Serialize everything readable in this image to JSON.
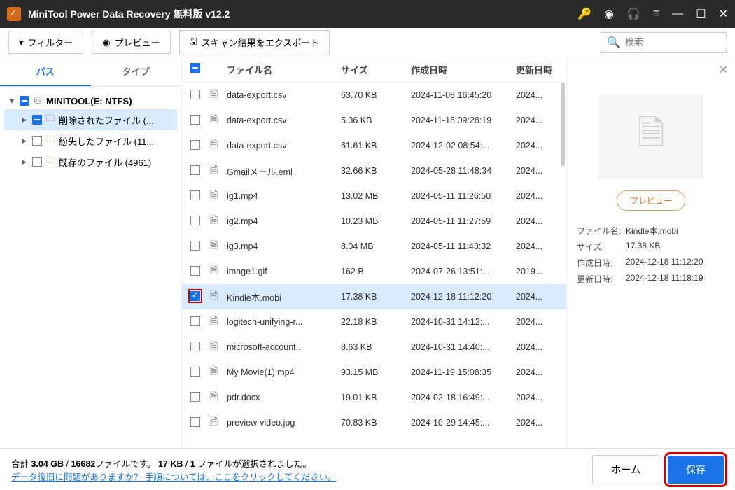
{
  "title": "MiniTool Power Data Recovery 無料版 v12.2",
  "toolbar": {
    "filter": "フィルター",
    "preview": "プレビュー",
    "export": "スキャン結果をエクスポート",
    "search_placeholder": "検索"
  },
  "side_tabs": {
    "path": "パス",
    "type": "タイプ"
  },
  "tree": {
    "root": "MINITOOL(E: NTFS)",
    "items": [
      {
        "label": "削除されたファイル (...",
        "icon": "folder-red",
        "sel": true
      },
      {
        "label": "紛失したファイル (11...",
        "icon": "folder-yellow"
      },
      {
        "label": "既存のファイル (4961)",
        "icon": "folder-plain"
      }
    ]
  },
  "columns": {
    "name": "ファイル名",
    "size": "サイズ",
    "created": "作成日時",
    "modified": "更新日時"
  },
  "files": [
    {
      "name": "data-export.csv",
      "size": "63.70 KB",
      "created": "2024-11-08 16:45:20",
      "mod": "2024..."
    },
    {
      "name": "data-export.csv",
      "size": "5.36 KB",
      "created": "2024-11-18 09:28:19",
      "mod": "2024..."
    },
    {
      "name": "data-export.csv",
      "size": "61.61 KB",
      "created": "2024-12-02 08:54:...",
      "mod": "2024..."
    },
    {
      "name": "Gmailメール.eml",
      "size": "32.66 KB",
      "created": "2024-05-28 11:48:34",
      "mod": "2024..."
    },
    {
      "name": "ig1.mp4",
      "size": "13.02 MB",
      "created": "2024-05-11 11:26:50",
      "mod": "2024..."
    },
    {
      "name": "ig2.mp4",
      "size": "10.23 MB",
      "created": "2024-05-11 11:27:59",
      "mod": "2024..."
    },
    {
      "name": "ig3.mp4",
      "size": "8.04 MB",
      "created": "2024-05-11 11:43:32",
      "mod": "2024..."
    },
    {
      "name": "image1.gif",
      "size": "162 B",
      "created": "2024-07-26 13:51:...",
      "mod": "2019..."
    },
    {
      "name": "Kindle本.mobi",
      "size": "17.38 KB",
      "created": "2024-12-18 11:12:20",
      "mod": "2024...",
      "checked": true,
      "sel": true,
      "hl": true
    },
    {
      "name": "logitech-unifying-r...",
      "size": "22.18 KB",
      "created": "2024-10-31 14:12:...",
      "mod": "2024..."
    },
    {
      "name": "microsoft-account...",
      "size": "8.63 KB",
      "created": "2024-10-31 14:40:...",
      "mod": "2024..."
    },
    {
      "name": "My Movie(1).mp4",
      "size": "93.15 MB",
      "created": "2024-11-19 15:08:35",
      "mod": "2024..."
    },
    {
      "name": "pdr.docx",
      "size": "19.01 KB",
      "created": "2024-02-18 16:49:...",
      "mod": "2024..."
    },
    {
      "name": "preview-video.jpg",
      "size": "70.83 KB",
      "created": "2024-10-29 14:45:...",
      "mod": "2024..."
    }
  ],
  "detail": {
    "preview_btn": "プレビュー",
    "labels": {
      "name": "ファイル名:",
      "size": "サイズ:",
      "created": "作成日時:",
      "modified": "更新日時:"
    },
    "name": "Kindle本.mobi",
    "size": "17.38 KB",
    "created": "2024-12-18 11:12:20",
    "modified": "2024-12-18 11:18:19"
  },
  "footer": {
    "summary_pre": "合計 ",
    "total_size": "3.04 GB",
    "sep1": " / ",
    "total_files": "16682",
    "summary_mid": "ファイルです。 ",
    "sel_size": "17 KB",
    "sep2": " / ",
    "sel_count": "1",
    "summary_post": " ファイルが選択されました。",
    "help_link": "データ復旧に問題がありますか？ 手順については、ここをクリックしてください。",
    "home": "ホーム",
    "save": "保存"
  }
}
